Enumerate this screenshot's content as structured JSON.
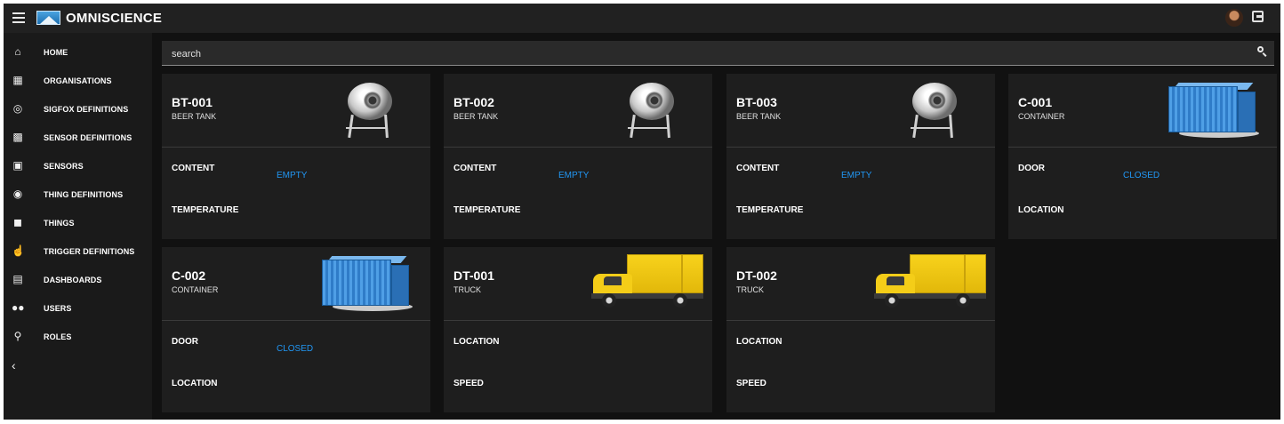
{
  "app": {
    "title": "OMNISCIENCE"
  },
  "sidebar": {
    "items": [
      {
        "label": "HOME",
        "icon": "home-icon"
      },
      {
        "label": "ORGANISATIONS",
        "icon": "organisations-icon"
      },
      {
        "label": "SIGFOX DEFINITIONS",
        "icon": "sigfox-icon"
      },
      {
        "label": "SENSOR DEFINITIONS",
        "icon": "sensor-definitions-icon"
      },
      {
        "label": "SENSORS",
        "icon": "sensors-icon"
      },
      {
        "label": "THING DEFINITIONS",
        "icon": "thing-definitions-icon"
      },
      {
        "label": "THINGS",
        "icon": "things-icon"
      },
      {
        "label": "TRIGGER DEFINITIONS",
        "icon": "trigger-icon"
      },
      {
        "label": "DASHBOARDS",
        "icon": "dashboards-icon"
      },
      {
        "label": "USERS",
        "icon": "users-icon"
      },
      {
        "label": "ROLES",
        "icon": "roles-icon"
      }
    ]
  },
  "search": {
    "value": "search"
  },
  "colors": {
    "accent": "#2196f3",
    "background": "#111111",
    "card": "#1e1e1e",
    "topbar": "#212121"
  },
  "cards": [
    {
      "id": "BT-001",
      "type": "BEER TANK",
      "image": "beer-tank-image",
      "fields": [
        {
          "label": "CONTENT",
          "value": "EMPTY"
        },
        {
          "label": "TEMPERATURE",
          "value": ""
        }
      ]
    },
    {
      "id": "BT-002",
      "type": "BEER TANK",
      "image": "beer-tank-image",
      "fields": [
        {
          "label": "CONTENT",
          "value": "EMPTY"
        },
        {
          "label": "TEMPERATURE",
          "value": ""
        }
      ]
    },
    {
      "id": "BT-003",
      "type": "BEER TANK",
      "image": "beer-tank-image",
      "fields": [
        {
          "label": "CONTENT",
          "value": "EMPTY"
        },
        {
          "label": "TEMPERATURE",
          "value": ""
        }
      ]
    },
    {
      "id": "C-001",
      "type": "CONTAINER",
      "image": "container-image",
      "fields": [
        {
          "label": "DOOR",
          "value": "CLOSED"
        },
        {
          "label": "LOCATION",
          "value": ""
        }
      ]
    },
    {
      "id": "C-002",
      "type": "CONTAINER",
      "image": "container-image",
      "fields": [
        {
          "label": "DOOR",
          "value": "CLOSED"
        },
        {
          "label": "LOCATION",
          "value": ""
        }
      ]
    },
    {
      "id": "DT-001",
      "type": "TRUCK",
      "image": "truck-image",
      "fields": [
        {
          "label": "LOCATION",
          "value": ""
        },
        {
          "label": "SPEED",
          "value": ""
        }
      ]
    },
    {
      "id": "DT-002",
      "type": "TRUCK",
      "image": "truck-image",
      "fields": [
        {
          "label": "LOCATION",
          "value": ""
        },
        {
          "label": "SPEED",
          "value": ""
        }
      ]
    }
  ]
}
